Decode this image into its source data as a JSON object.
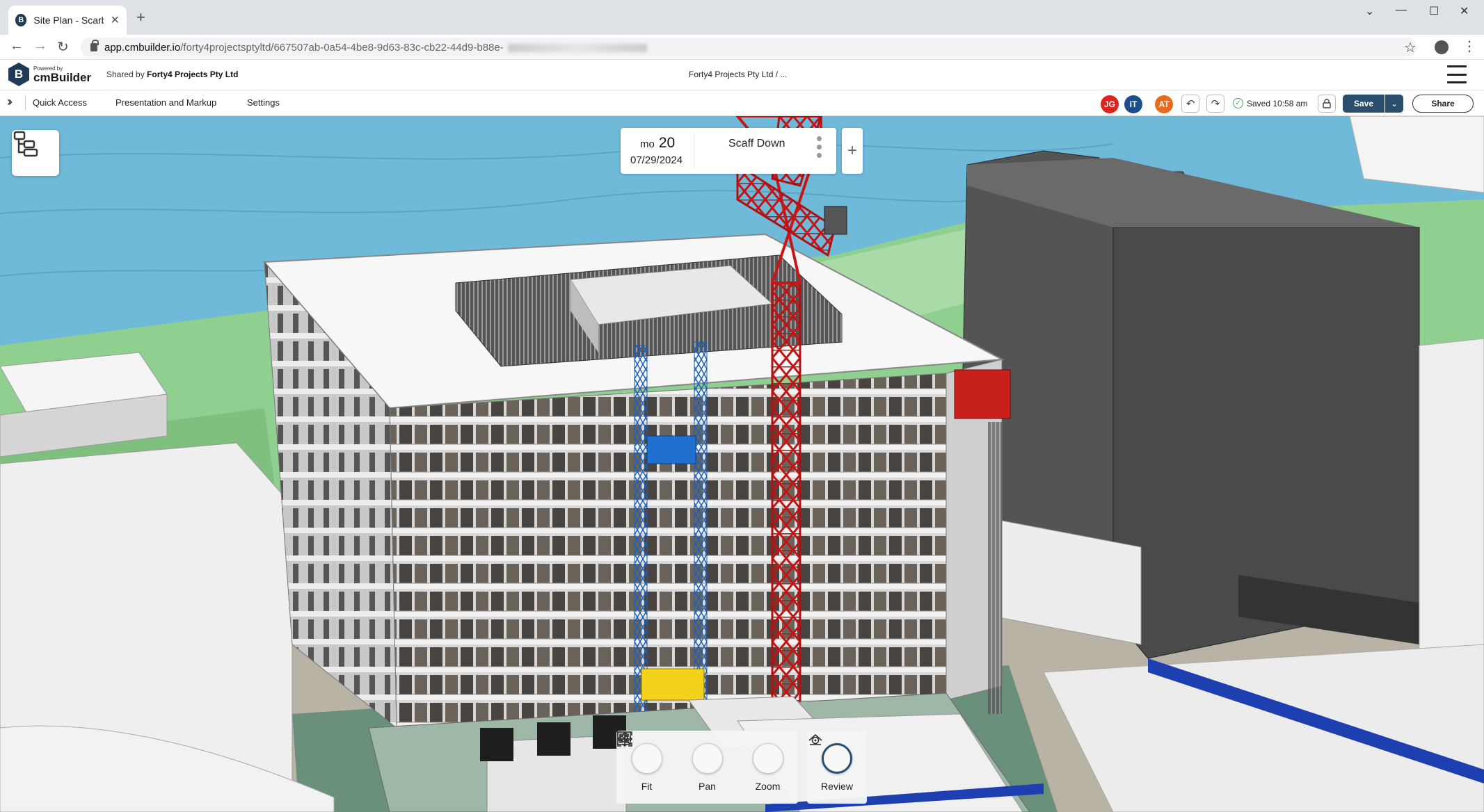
{
  "browser": {
    "tab_title": "Site Plan - Scarboro",
    "favicon_letter": "B",
    "url_host": "app.cmbuilder.io",
    "url_path": "/forty4projectsptyltd/667507ab-0a54-4be8-9d63-83c-cb22-44d9-b88e-"
  },
  "app": {
    "powered_by": "Powered by",
    "brand_name": "cmBuilder",
    "brand_letter": "B",
    "shared_prefix": "Shared by",
    "shared_owner": "Forty4 Projects Pty Ltd",
    "project_crumb": "Forty4 Projects Pty Ltd / ..."
  },
  "toolbar": {
    "menu": [
      "Quick Access",
      "Presentation and Markup",
      "Settings"
    ],
    "avatars": [
      {
        "initials": "JG",
        "color": "#e0231c"
      },
      {
        "initials": "IT",
        "color": "#1f4e8c"
      },
      {
        "initials": "AT",
        "color": "#e96a1c"
      }
    ],
    "saved_label": "Saved 10:58 am",
    "save_label": "Save",
    "share_label": "Share"
  },
  "phase": {
    "day_of_week": "mo",
    "day_number": "20",
    "date": "07/29/2024",
    "name": "Scaff Down"
  },
  "nav_tools": [
    {
      "label": "Fit",
      "icon": "fit-icon"
    },
    {
      "label": "Pan",
      "icon": "pan-icon"
    },
    {
      "label": "Zoom",
      "icon": "zoom-icon"
    }
  ],
  "review_tool": {
    "label": "Review",
    "icon": "review-icon"
  },
  "colors": {
    "brand_navy": "#2a4e6e",
    "crane_red": "#d11a1a",
    "water_blue": "#6fb9d9",
    "grass_green": "#8fcf8f"
  }
}
